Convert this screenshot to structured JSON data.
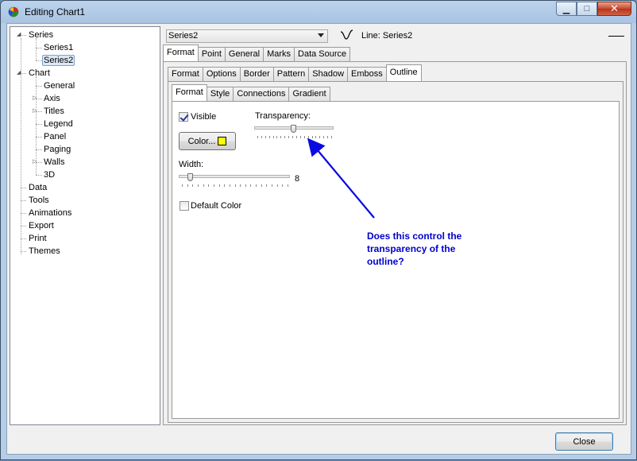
{
  "window": {
    "title": "Editing Chart1"
  },
  "tree": {
    "items": [
      {
        "label": "Series",
        "level": 0,
        "expander": "collapse"
      },
      {
        "label": "Series1",
        "level": 1
      },
      {
        "label": "Series2",
        "level": 1,
        "selected": true
      },
      {
        "label": "Chart",
        "level": 0,
        "expander": "collapse"
      },
      {
        "label": "General",
        "level": 1
      },
      {
        "label": "Axis",
        "level": 1,
        "expander": "expand"
      },
      {
        "label": "Titles",
        "level": 1,
        "expander": "expand"
      },
      {
        "label": "Legend",
        "level": 1
      },
      {
        "label": "Panel",
        "level": 1
      },
      {
        "label": "Paging",
        "level": 1
      },
      {
        "label": "Walls",
        "level": 1,
        "expander": "expand"
      },
      {
        "label": "3D",
        "level": 1
      },
      {
        "label": "Data",
        "level": 0
      },
      {
        "label": "Tools",
        "level": 0
      },
      {
        "label": "Animations",
        "level": 0
      },
      {
        "label": "Export",
        "level": 0
      },
      {
        "label": "Print",
        "level": 0
      },
      {
        "label": "Themes",
        "level": 0
      }
    ]
  },
  "series_combo": {
    "value": "Series2"
  },
  "series_info": {
    "type_label": "Line: Series2"
  },
  "tabs_main": [
    "Format",
    "Point",
    "General",
    "Marks",
    "Data Source"
  ],
  "tabs_format": [
    "Format",
    "Options",
    "Border",
    "Pattern",
    "Shadow",
    "Emboss",
    "Outline"
  ],
  "tabs_outline": [
    "Format",
    "Style",
    "Connections",
    "Gradient"
  ],
  "outline_format": {
    "visible_label": "Visible",
    "visible_checked": true,
    "color_button_label": "Color...",
    "color_swatch": "#ffff00",
    "transparency_label": "Transparency:",
    "transparency_level": 0.5,
    "width_label": "Width:",
    "width_value": "8",
    "width_level": 0.08,
    "default_color_label": "Default Color",
    "default_color_checked": false
  },
  "annotation": {
    "text": "Does this control the transparency of the outline?",
    "color": "#0000cc"
  },
  "footer": {
    "close_label": "Close"
  }
}
